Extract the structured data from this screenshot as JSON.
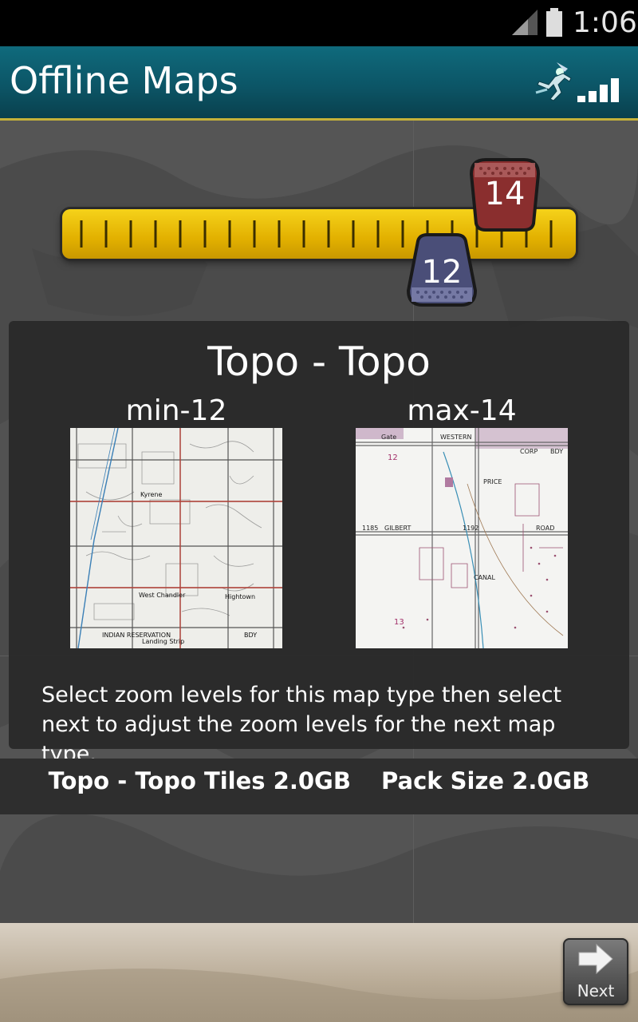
{
  "status": {
    "time": "1:06"
  },
  "header": {
    "title": "Offline Maps"
  },
  "slider": {
    "min_label": "12",
    "max_label": "14"
  },
  "panel": {
    "title": "Topo - Topo",
    "min_caption": "min-12",
    "max_caption": "max-14",
    "description": "Select zoom levels for this map type then select next to adjust the zoom levels for the next map type."
  },
  "summary": {
    "tiles": "Topo - Topo Tiles 2.0GB",
    "pack": "Pack Size 2.0GB"
  },
  "footer": {
    "next_label": "Next"
  },
  "colors": {
    "header": "#0c5566",
    "accent_line": "#c5b23a",
    "slider": "#e2b000",
    "handle_max": "#8a2e2e",
    "handle_min": "#4a4e78"
  },
  "map_labels": {
    "min": [
      "Kyrene",
      "West Chandler",
      "Hightown",
      "INDIAN RESERVATION",
      "Landing Strip",
      "BDY"
    ],
    "max": [
      "Gate",
      "WESTERN",
      "12",
      "CORP",
      "BDY",
      "PRICE",
      "GILBERT",
      "1192",
      "ROAD",
      "1185",
      "CANAL",
      "13"
    ]
  }
}
